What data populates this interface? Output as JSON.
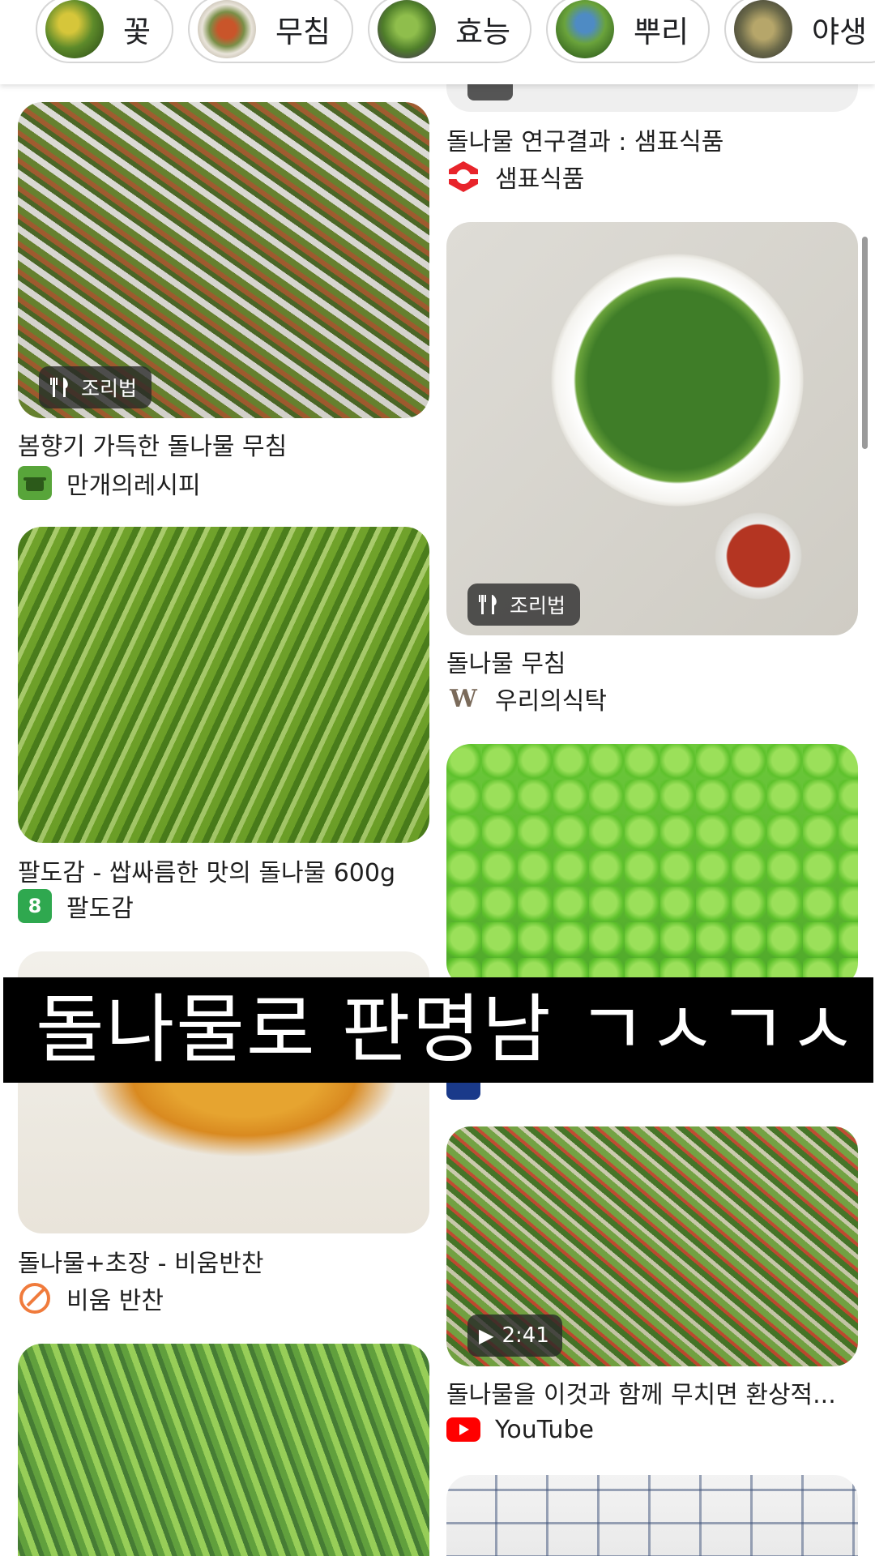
{
  "chips": [
    {
      "label": "꽃"
    },
    {
      "label": "무침"
    },
    {
      "label": "효능"
    },
    {
      "label": "뿌리"
    },
    {
      "label": "야생"
    }
  ],
  "left_column": [
    {
      "title": "봄향기 가득한 돌나물 무침",
      "source": "만개의레시피",
      "badge": "조리법",
      "source_icon": "pot-icon"
    },
    {
      "title": "팔도감 - 쌉싸름한 맛의 돌나물 600g",
      "source": "팔도감",
      "badge": "",
      "source_icon": "paldogam-logo-icon"
    },
    {
      "title": "돌나물+초장 - 비움반찬",
      "source": "비움 반찬",
      "badge": "",
      "source_icon": "bium-logo-icon"
    },
    {
      "title": "",
      "source": "",
      "badge": ""
    }
  ],
  "right_column": [
    {
      "title": "돌나물 연구결과 : 샘표식품",
      "source": "샘표식품",
      "badge": "",
      "source_icon": "sempio-logo-icon"
    },
    {
      "title": "돌나물 무침",
      "source": "우리의식탁",
      "badge": "조리법",
      "source_icon": "w-logo-icon"
    },
    {
      "title": "",
      "source": "",
      "badge": ""
    },
    {
      "title": "돌나물을 이것과 함께 무치면 환상적...",
      "source": "YouTube",
      "badge": "2:41",
      "source_icon": "youtube-icon"
    }
  ],
  "overlay": {
    "text": "돌나물로 판명남 ㄱㅅㄱㅅ"
  },
  "colors": {
    "accent_red": "#e8242b",
    "youtube_red": "#ff0000",
    "paldogam_green": "#2fa84f",
    "manggae_green": "#58a53a",
    "bium_orange": "#f07b3c"
  }
}
